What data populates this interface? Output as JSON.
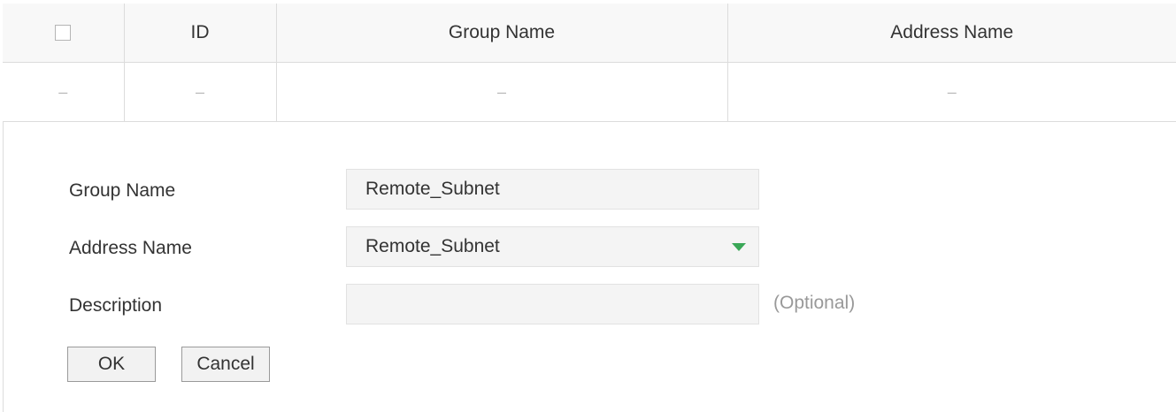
{
  "table": {
    "headers": {
      "id": "ID",
      "group_name": "Group Name",
      "address_name": "Address Name"
    },
    "empty_row": {
      "checkbox": "–",
      "id": "–",
      "group_name": "–",
      "address_name": "–"
    }
  },
  "form": {
    "group_name": {
      "label": "Group Name",
      "value": "Remote_Subnet"
    },
    "address_name": {
      "label": "Address Name",
      "value": "Remote_Subnet"
    },
    "description": {
      "label": "Description",
      "value": "",
      "hint": "(Optional)"
    },
    "ok_label": "OK",
    "cancel_label": "Cancel"
  },
  "colors": {
    "dropdown_arrow": "#3aa757",
    "field_background": "#f4f4f4",
    "hint_text": "#999999"
  }
}
